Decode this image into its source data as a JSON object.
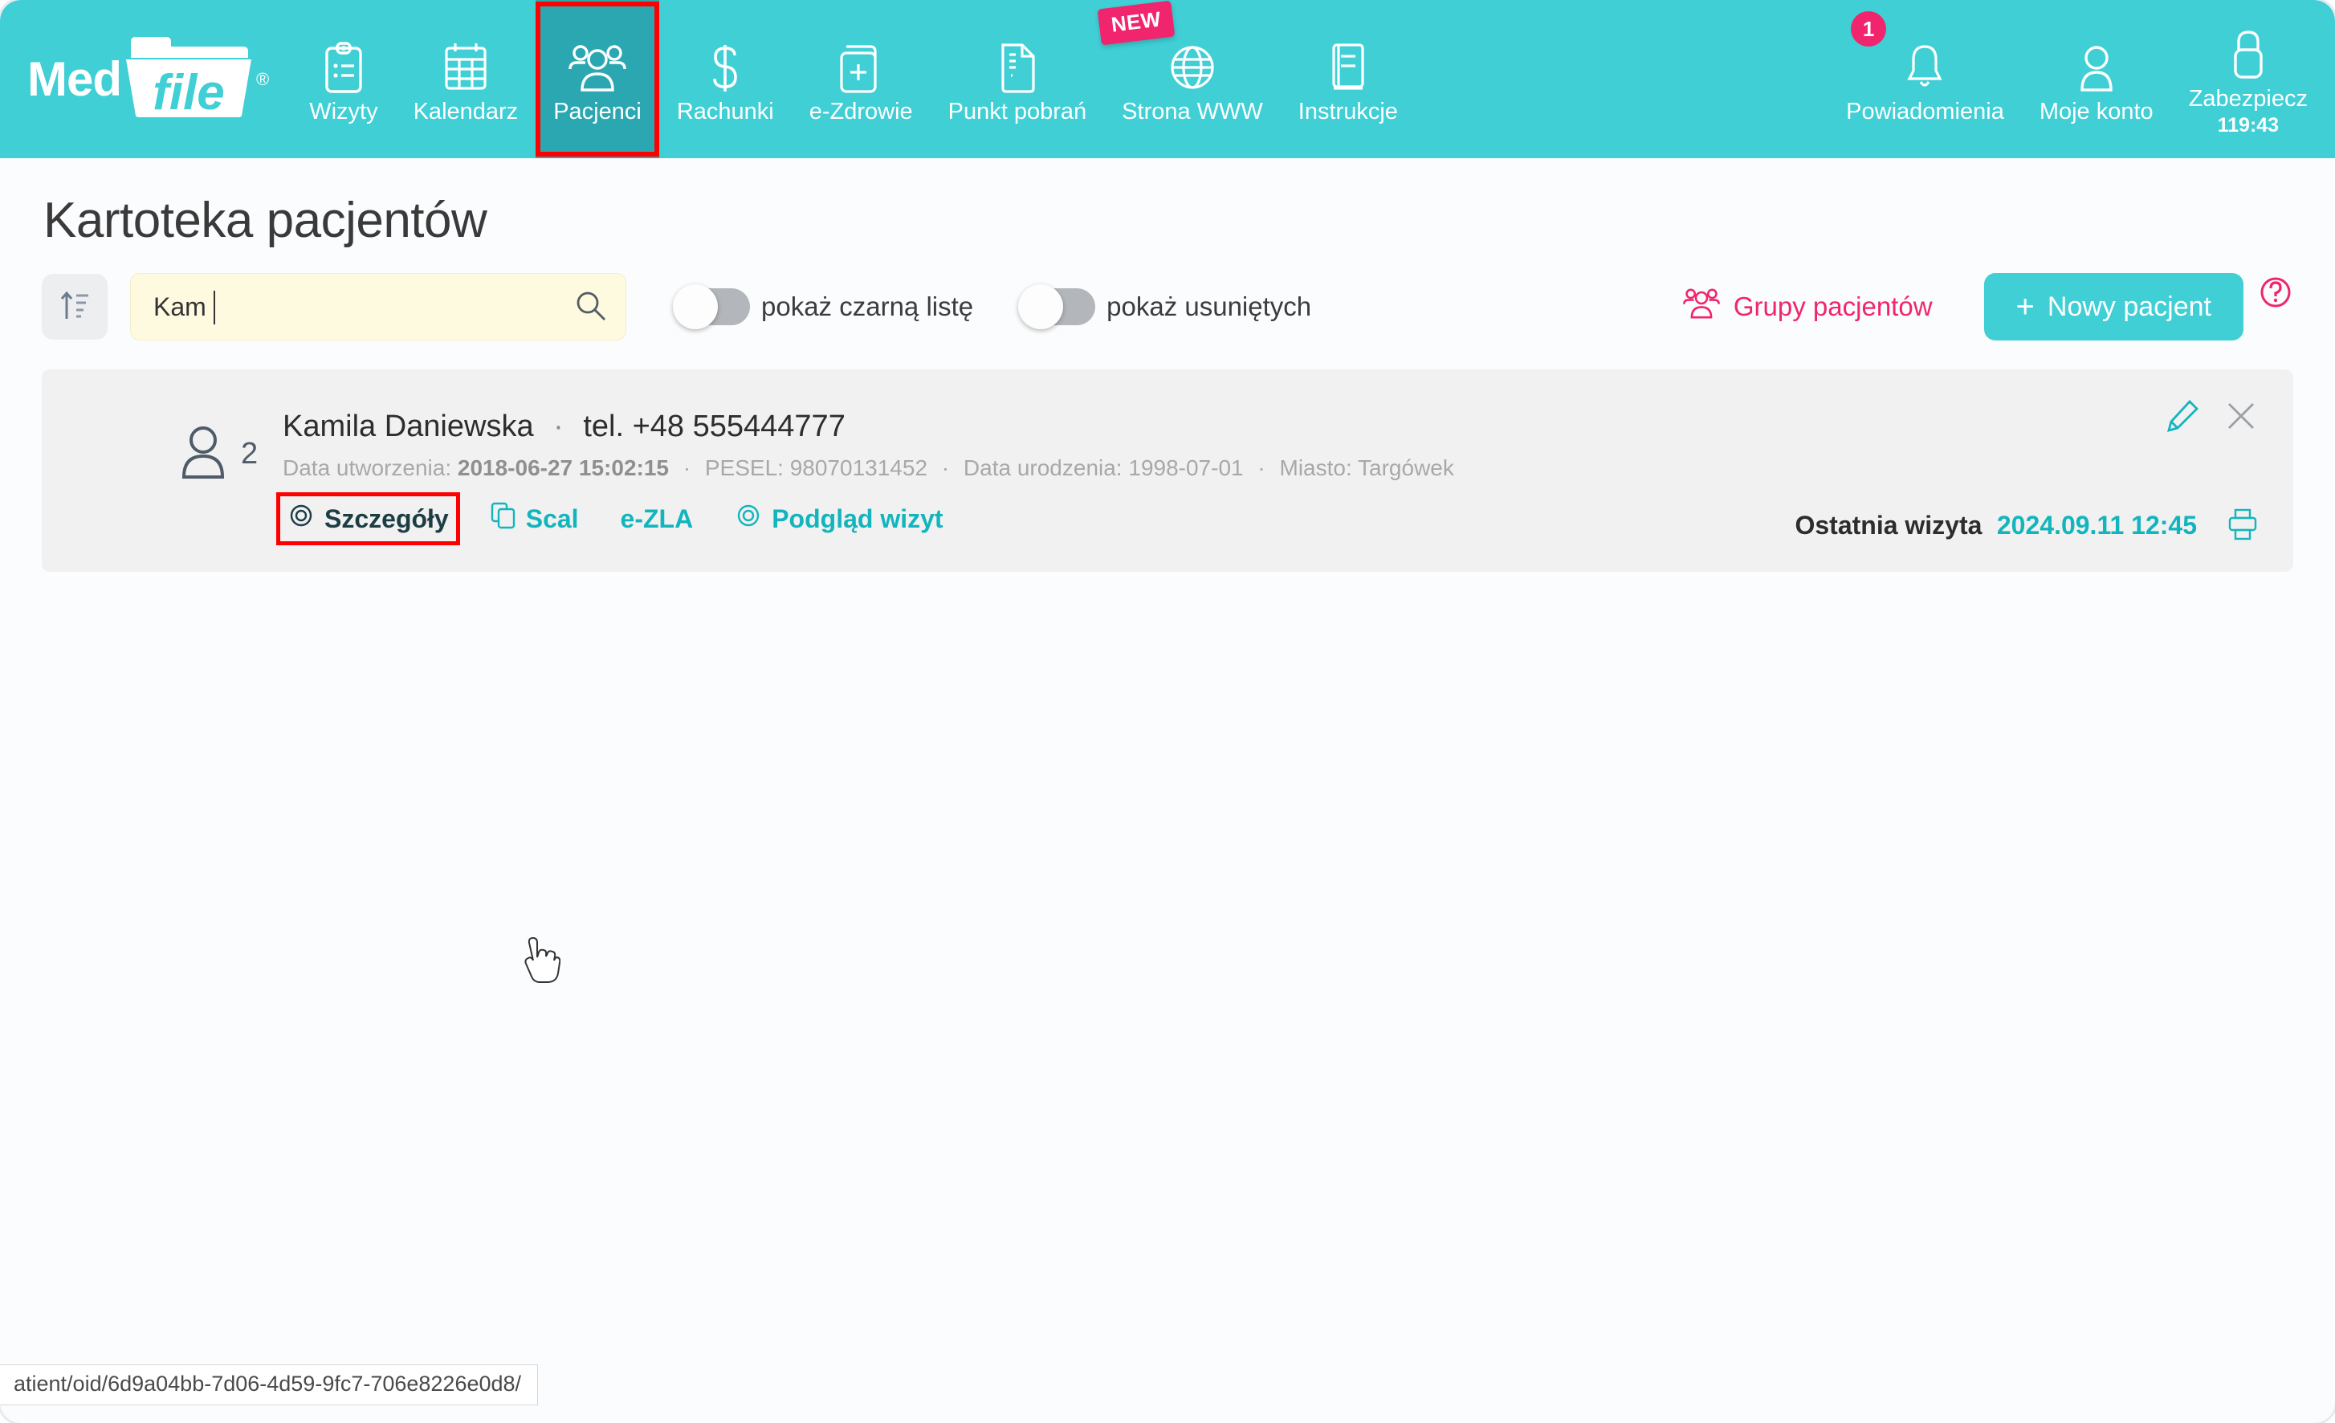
{
  "brand": {
    "word1": "Med",
    "word2": "file",
    "registered": "®"
  },
  "nav": {
    "items": [
      {
        "label": "Wizyty",
        "icon": "clipboard-icon",
        "active": false,
        "highlighted": false
      },
      {
        "label": "Kalendarz",
        "icon": "calendar-icon",
        "active": false,
        "highlighted": false
      },
      {
        "label": "Pacjenci",
        "icon": "patients-group-icon",
        "active": true,
        "highlighted": true
      },
      {
        "label": "Rachunki",
        "icon": "dollar-icon",
        "active": false,
        "highlighted": false
      },
      {
        "label": "e-Zdrowie",
        "icon": "medical-record-icon",
        "active": false,
        "highlighted": false
      },
      {
        "label": "Punkt pobrań",
        "icon": "document-icon",
        "active": false,
        "highlighted": false
      },
      {
        "label": "Strona WWW",
        "icon": "globe-icon",
        "active": false,
        "highlighted": false,
        "badge": "NEW"
      },
      {
        "label": "Instrukcje",
        "icon": "book-icon",
        "active": false,
        "highlighted": false
      }
    ],
    "right_items": [
      {
        "label": "Powiadomienia",
        "icon": "bell-icon",
        "badge_count": "1"
      },
      {
        "label": "Moje konto",
        "icon": "user-icon"
      },
      {
        "label": "Zabezpiecz",
        "icon": "lock-icon",
        "timer": "119:43"
      }
    ]
  },
  "page": {
    "title": "Kartoteka pacjentów"
  },
  "toolbar": {
    "sort_icon": "sort-ascending-icon",
    "search": {
      "value": "Kam",
      "placeholder": "",
      "icon": "search-icon"
    },
    "toggles": [
      {
        "label": "pokaż czarną listę",
        "on": false
      },
      {
        "label": "pokaż usuniętych",
        "on": false
      }
    ],
    "groups_label": "Grupy pacjentów",
    "groups_icon": "patients-group-icon",
    "new_patient_label": "Nowy pacjent",
    "new_patient_plus": "+",
    "help_icon": "question-mark-icon"
  },
  "patients": [
    {
      "avatar_count": "2",
      "name": "Kamila Daniewska",
      "separator": "·",
      "phone": "tel. +48 555444777",
      "meta": {
        "created_label": "Data utworzenia:",
        "created_value": "2018-06-27 15:02:15",
        "pesel_label": "PESEL:",
        "pesel_value": "98070131452",
        "birth_label": "Data urodzenia:",
        "birth_value": "1998-07-01",
        "city_label": "Miasto:",
        "city_value": "Targówek",
        "bullet": "·"
      },
      "links": [
        {
          "label": "Szczegóły",
          "icon": "eye-icon",
          "hovered": true,
          "highlighted": true
        },
        {
          "label": "Scal",
          "icon": "copy-icon",
          "hovered": false,
          "highlighted": false
        },
        {
          "label": "e-ZLA",
          "icon": "",
          "hovered": false,
          "highlighted": false
        },
        {
          "label": "Podgląd wizyt",
          "icon": "eye-icon",
          "hovered": false,
          "highlighted": false
        }
      ],
      "edit_icon": "pencil-icon",
      "delete_icon": "close-x-icon",
      "print_icon": "printer-icon",
      "last_visit_label": "Ostatnia wizyta",
      "last_visit_date": "2024.09.11 12:45"
    }
  ],
  "status_bar": {
    "url": "atient/oid/6d9a04bb-7d06-4d59-9fc7-706e8226e0d8/"
  },
  "colors": {
    "brand_teal": "#3fcfd5",
    "active_teal": "#2ba7b2",
    "link_teal": "#13b5bd",
    "pink": "#f0256e",
    "highlight_red": "#ff0000",
    "search_bg": "#fdfae0",
    "card_bg": "#f1f1f1"
  }
}
